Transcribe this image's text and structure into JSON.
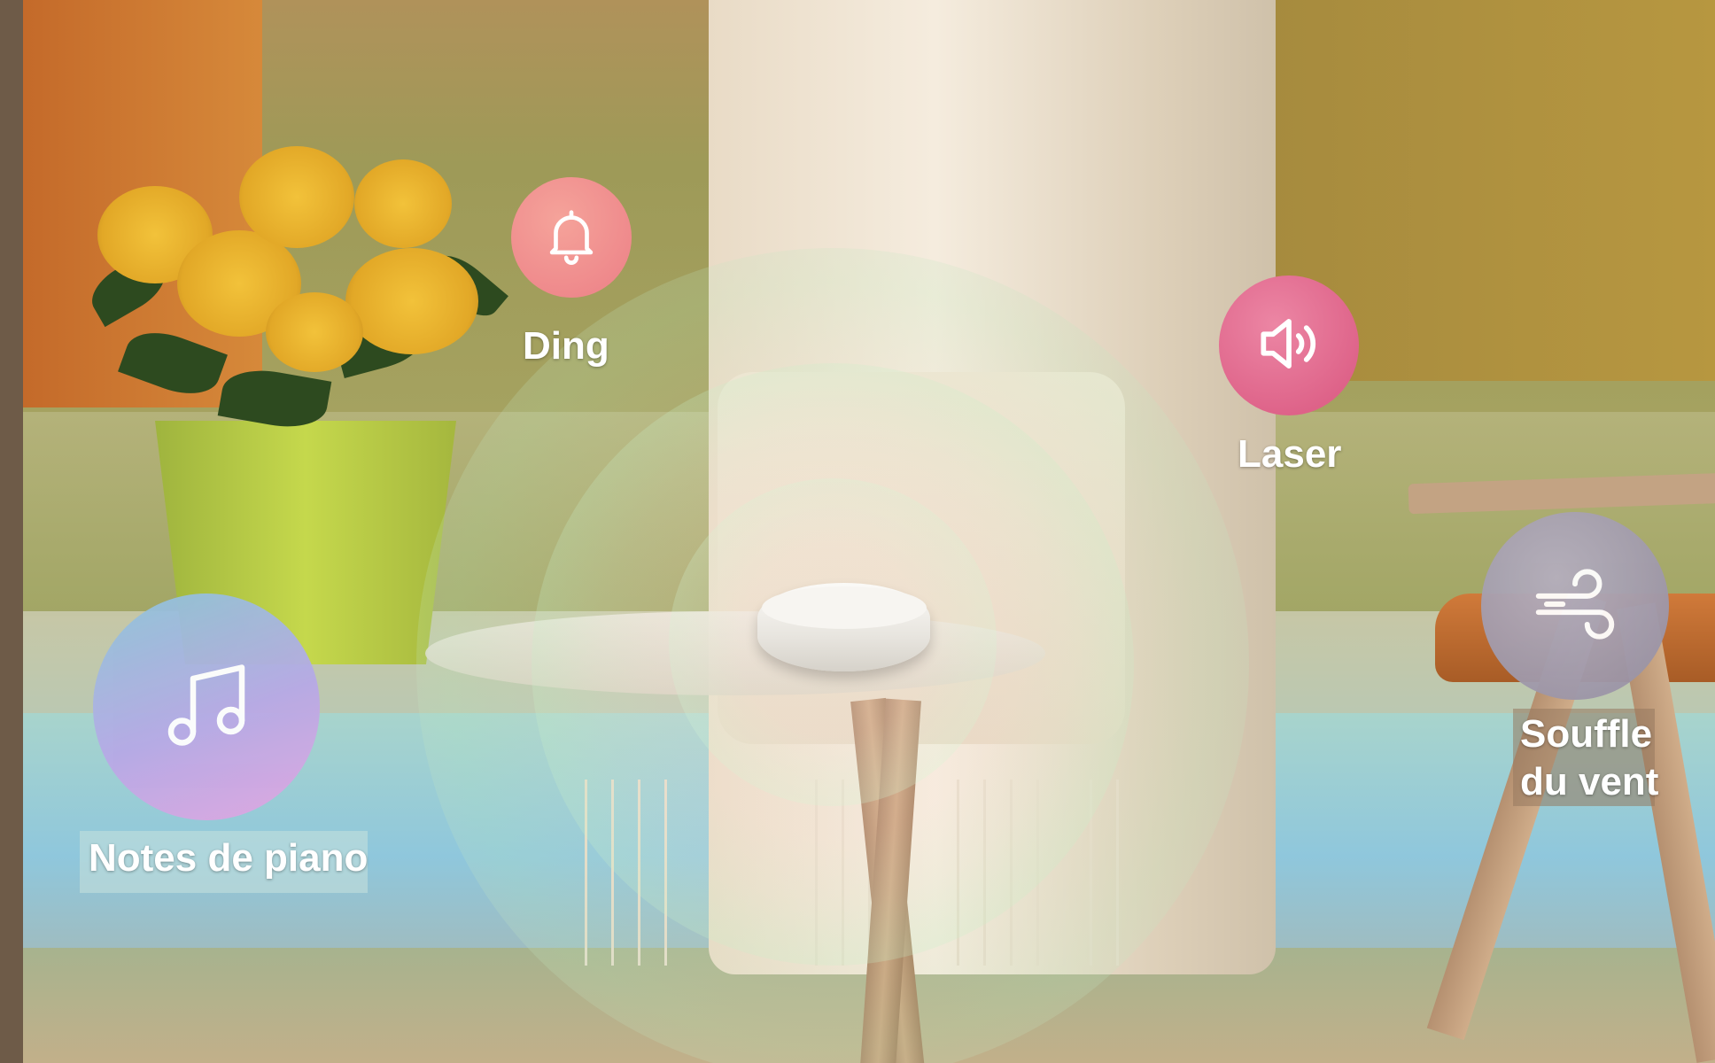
{
  "sound_options": [
    {
      "label": "Ding",
      "icon": "bell-icon",
      "color": "#f08a8a"
    },
    {
      "label": "Laser",
      "icon": "speaker-volume-icon",
      "color": "#e06a92"
    },
    {
      "label": "Notes de piano",
      "icon": "music-note-icon",
      "color": "#a9b8e6"
    },
    {
      "label_line1": "Souffle",
      "label_line2": "du vent",
      "icon": "wind-icon",
      "color": "#9d98a8"
    }
  ]
}
